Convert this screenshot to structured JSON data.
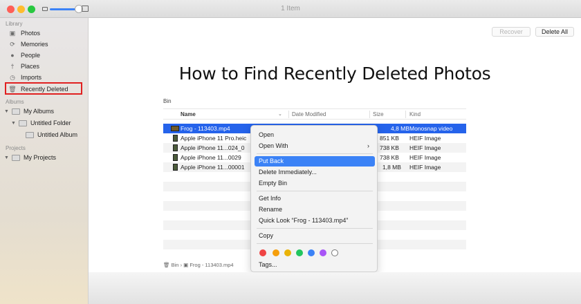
{
  "window": {
    "title": "1 Item"
  },
  "sidebar": {
    "library_label": "Library",
    "library_items": [
      "Photos",
      "Memories",
      "People",
      "Places",
      "Imports",
      "Recently Deleted"
    ],
    "albums_label": "Albums",
    "my_albums": "My Albums",
    "untitled_folder": "Untitled Folder",
    "untitled_album": "Untitled Album",
    "projects_label": "Projects",
    "my_projects": "My Projects"
  },
  "toolbar": {
    "recover_label": "Recover",
    "delete_all_label": "Delete All"
  },
  "headline": "How to Find Recently Deleted Photos",
  "bin": {
    "label": "Bin",
    "columns": {
      "name": "Name",
      "date_modified": "Date Modified",
      "size": "Size",
      "kind": "Kind"
    },
    "rows": [
      {
        "name": "Frog - 113403.mp4",
        "size": "4,8 MB",
        "kind": "Monosnap video"
      },
      {
        "name": "Apple iPhone 11 Pro.heic",
        "size": "851 KB",
        "kind": "HEIF Image"
      },
      {
        "name": "Apple iPhone 11...024_0",
        "size": "738 KB",
        "kind": "HEIF Image"
      },
      {
        "name": "Apple iPhone 11...0029",
        "size": "738 KB",
        "kind": "HEIF Image"
      },
      {
        "name": "Apple iPhone 11...00001",
        "size": "1,8 MB",
        "kind": "HEIF Image"
      }
    ],
    "path": {
      "bin": "Bin",
      "file": "Frog - 113403.mp4"
    }
  },
  "context_menu": {
    "open": "Open",
    "open_with": "Open With",
    "put_back": "Put Back",
    "delete_immediately": "Delete Immediately...",
    "empty_bin": "Empty Bin",
    "get_info": "Get Info",
    "rename": "Rename",
    "quick_look": "Quick Look “Frog - 113403.mp4”",
    "copy": "Copy",
    "tags": "Tags...",
    "tag_colors": [
      "#ef4444",
      "#f59e0b",
      "#eab308",
      "#22c55e",
      "#3b82f6",
      "#a855f7",
      "#ffffff"
    ]
  },
  "colors": {
    "accent": "#2563eb",
    "highlight_box": "#e02020"
  }
}
